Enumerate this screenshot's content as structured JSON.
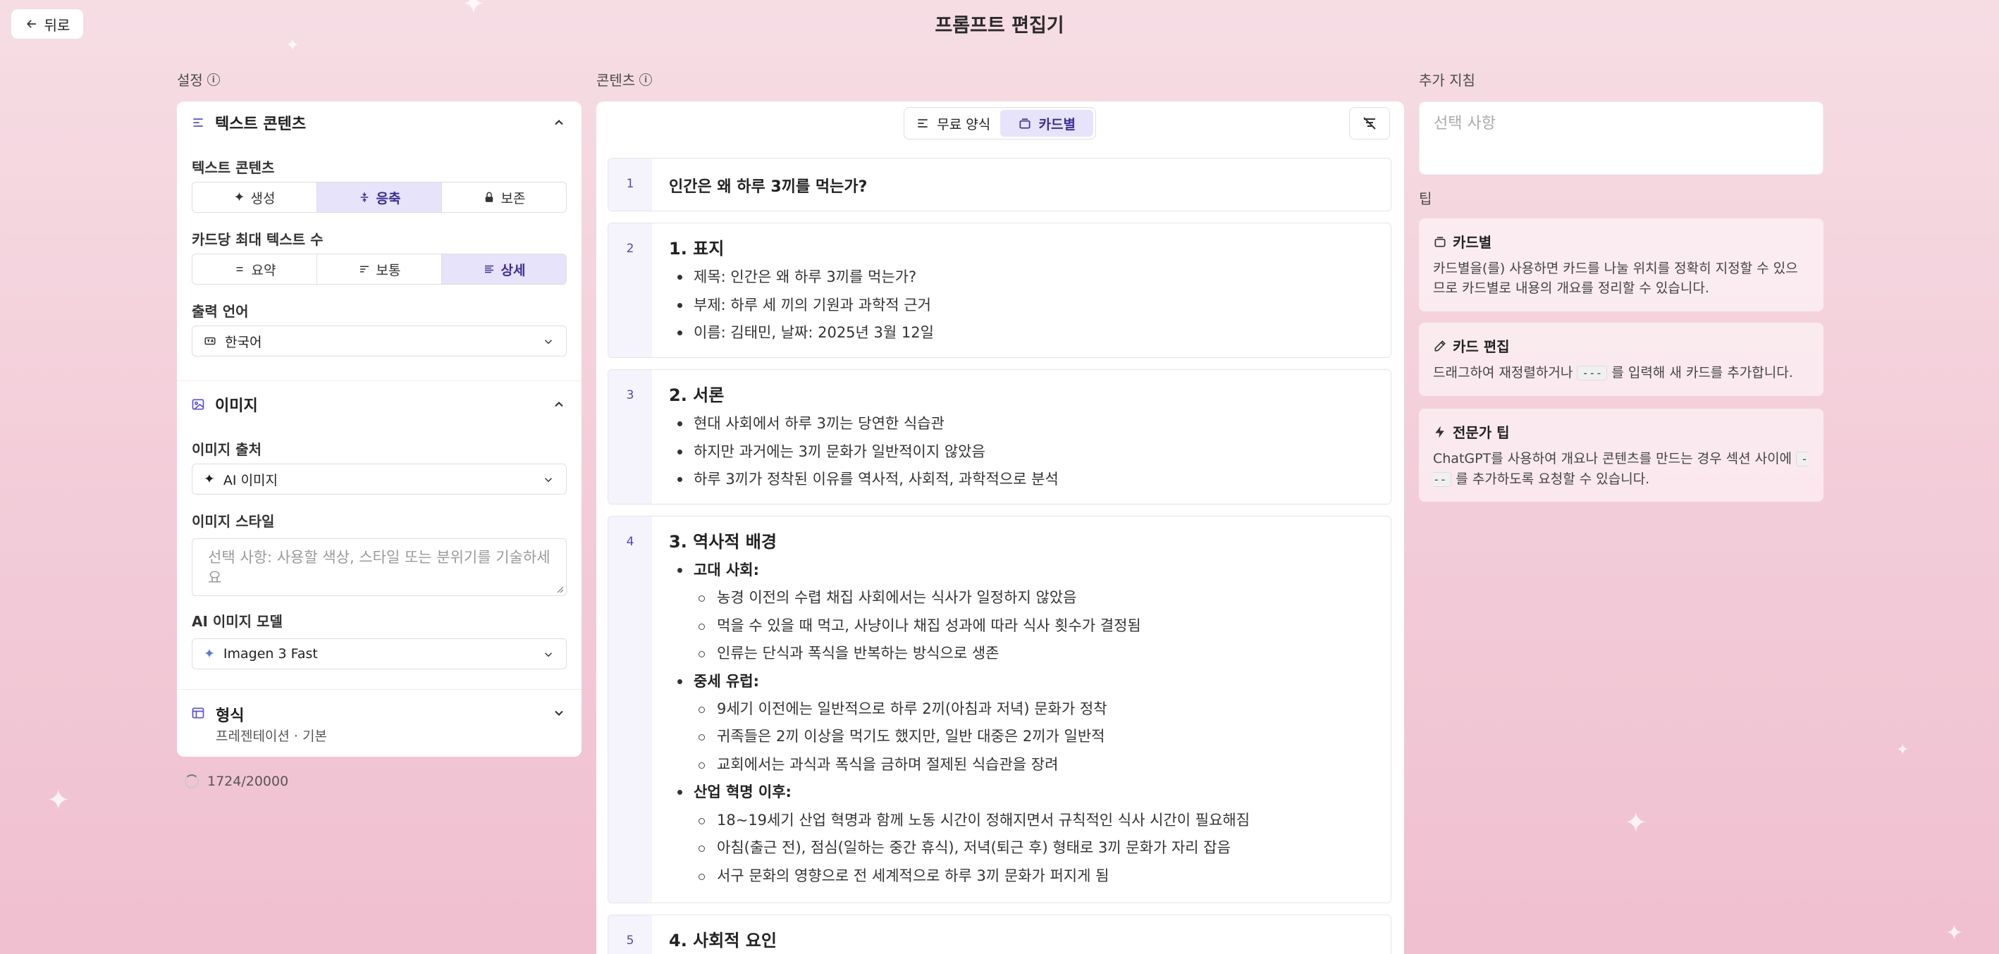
{
  "header": {
    "back_label": "뒤로",
    "title": "프롬프트 편집기"
  },
  "labels": {
    "settings": "설정",
    "content": "콘텐츠",
    "extra": "추가 지침",
    "tips": "팁"
  },
  "left": {
    "text_section": {
      "title": "텍스트 콘텐츠",
      "mode_label": "텍스트 콘텐츠",
      "modes": [
        "생성",
        "응축",
        "보존"
      ],
      "mode_selected": "응축",
      "density_label": "카드당 최대 텍스트 수",
      "densities": [
        "요약",
        "보통",
        "상세"
      ],
      "density_selected": "상세",
      "lang_label": "출력 언어",
      "lang_value": "한국어"
    },
    "image_section": {
      "title": "이미지",
      "source_label": "이미지 출처",
      "source_value": "AI 이미지",
      "style_label": "이미지 스타일",
      "style_placeholder": "선택 사항: 사용할 색상, 스타일 또는 분위기를 기술하세요",
      "model_label": "AI 이미지 모델",
      "model_value": "Imagen 3 Fast"
    },
    "format_section": {
      "title": "형식",
      "subtitle": "프레젠테이션 · 기본"
    },
    "counter": "1724/20000"
  },
  "center": {
    "toggle": [
      "무료 양식",
      "카드별"
    ],
    "toggle_selected": "카드별",
    "cards": [
      {
        "num": "1",
        "heading": "인간은 왜 하루 3끼를 먹는가?"
      },
      {
        "num": "2",
        "heading": "1. 표지",
        "lines": [
          "제목: 인간은 왜 하루 3끼를 먹는가?",
          "부제: 하루 세 끼의 기원과 과학적 근거",
          "이름: 김태민, 날짜: 2025년 3월 12일"
        ]
      },
      {
        "num": "3",
        "heading": "2. 서론",
        "lines": [
          "현대 사회에서 하루 3끼는 당연한 식습관",
          "하지만 과거에는 3끼 문화가 일반적이지 않았음",
          "하루 3끼가 정착된 이유를 역사적, 사회적, 과학적으로 분석"
        ]
      },
      {
        "num": "4",
        "heading": "3. 역사적 배경",
        "groups": [
          {
            "title": "고대 사회:",
            "items": [
              "농경 이전의 수렵 채집 사회에서는 식사가 일정하지 않았음",
              "먹을 수 있을 때 먹고, 사냥이나 채집 성과에 따라 식사 횟수가 결정됨",
              "인류는 단식과 폭식을 반복하는 방식으로 생존"
            ]
          },
          {
            "title": "중세 유럽:",
            "items": [
              "9세기 이전에는 일반적으로 하루 2끼(아침과 저녁) 문화가 정착",
              "귀족들은 2끼 이상을 먹기도 했지만, 일반 대중은 2끼가 일반적",
              "교회에서는 과식과 폭식을 금하며 절제된 식습관을 장려"
            ]
          },
          {
            "title": "산업 혁명 이후:",
            "items": [
              "18~19세기 산업 혁명과 함께 노동 시간이 정해지면서 규칙적인 식사 시간이 필요해짐",
              "아침(출근 전), 점심(일하는 중간 휴식), 저녁(퇴근 후) 형태로 3끼 문화가 자리 잡음",
              "서구 문화의 영향으로 전 세계적으로 하루 3끼 문화가 퍼지게 됨"
            ]
          }
        ]
      },
      {
        "num": "5",
        "heading": "4. 사회적 요인"
      }
    ]
  },
  "right": {
    "placeholder": "선택 사항",
    "tips": [
      {
        "title": "카드별",
        "text": "카드별을(를) 사용하면 카드를 나눌 위치를 정확히 지정할 수 있으므로 카드별로 내용의 개요를 정리할 수 있습니다."
      },
      {
        "title": "카드 편집",
        "text_before": "드래그하여 재정렬하거나 ",
        "code": "---",
        "text_after": " 를 입력해 새 카드를 추가합니다."
      },
      {
        "title": "전문가 팁",
        "text_before": "ChatGPT를 사용하여 개요나 콘텐츠를 만드는 경우 섹션 사이에 ",
        "code": "---",
        "text_after": " 를 추가하도록 요청할 수 있습니다."
      }
    ]
  }
}
